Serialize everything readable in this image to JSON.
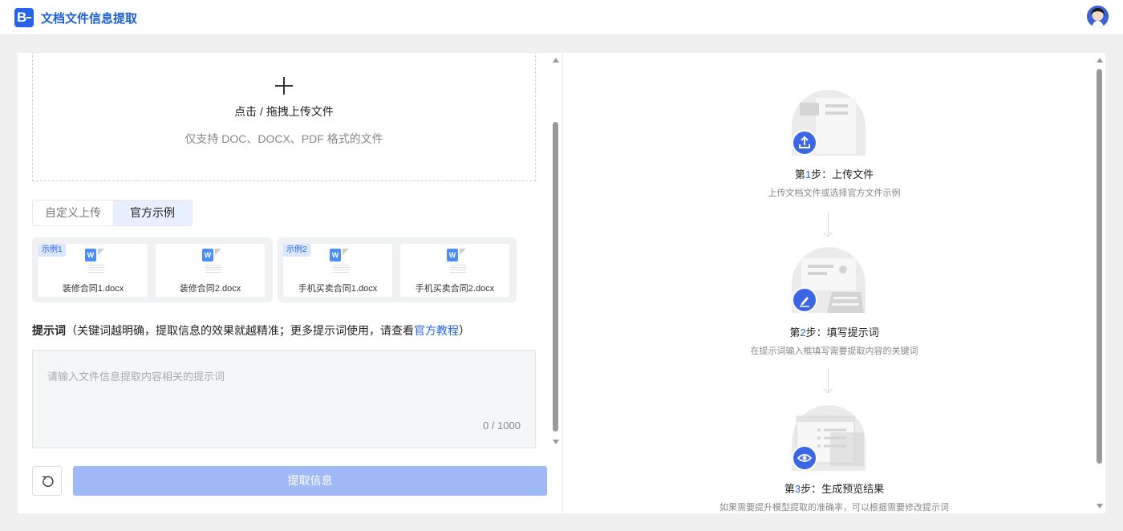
{
  "header": {
    "logo_text": "B",
    "title": "文档文件信息提取"
  },
  "upload": {
    "title": "点击 / 拖拽上传文件",
    "hint": "仅支持 DOC、DOCX、PDF 格式的文件"
  },
  "tabs": [
    {
      "label": "自定义上传",
      "active": false
    },
    {
      "label": "官方示例",
      "active": true
    }
  ],
  "examples": [
    {
      "tag": "示例1",
      "files": [
        "装修合同1.docx",
        "装修合同2.docx"
      ]
    },
    {
      "tag": "示例2",
      "files": [
        "手机买卖合同1.docx",
        "手机买卖合同2.docx"
      ]
    }
  ],
  "prompt": {
    "label": "提示词",
    "hint_before": "（关键词越明确，提取信息的效果就越精准；更多提示词使用，请查看",
    "link": "官方教程",
    "hint_after": "）",
    "placeholder": "请输入文件信息提取内容相关的提示词",
    "count": "0 / 1000"
  },
  "actions": {
    "submit_label": "提取信息"
  },
  "steps": [
    {
      "num_prefix": "第",
      "num": "1",
      "num_suffix": "步：",
      "title": "上传文件",
      "desc": "上传文档文件或选择官方文件示例",
      "icon": "upload-icon"
    },
    {
      "num_prefix": "第",
      "num": "2",
      "num_suffix": "步：",
      "title": "填写提示词",
      "desc": "在提示词输入框填写需要提取内容的关键词",
      "icon": "edit-icon"
    },
    {
      "num_prefix": "第",
      "num": "3",
      "num_suffix": "步：",
      "title": "生成预览结果",
      "desc": "如果需要提升模型提取的准确率，可以根据需要修改提示词",
      "icon": "eye-icon"
    }
  ],
  "colors": {
    "accent": "#2563eb",
    "submit_disabled": "#9fbaf7",
    "tab_active_bg": "#e8efff"
  }
}
